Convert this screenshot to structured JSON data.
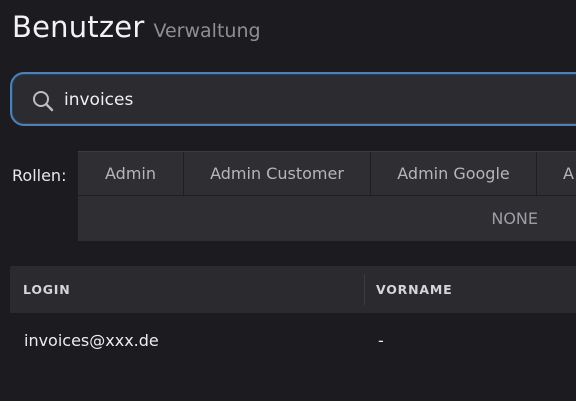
{
  "header": {
    "title": "Benutzer",
    "subtitle": "Verwaltung"
  },
  "search": {
    "value": "invoices",
    "icon": "search-icon"
  },
  "roles": {
    "label": "Rollen:",
    "tabs": [
      {
        "label": "Admin"
      },
      {
        "label": "Admin Customer"
      },
      {
        "label": "Admin Google"
      },
      {
        "label": "A"
      }
    ],
    "none_label": "NONE"
  },
  "table": {
    "columns": [
      "LOGIN",
      "VORNAME"
    ],
    "rows": [
      {
        "login": "invoices@xxx.de",
        "vorname": "-"
      }
    ]
  },
  "colors": {
    "background": "#1c1c20",
    "accent": "#4f7fb4",
    "panel": "#2e2e33"
  }
}
